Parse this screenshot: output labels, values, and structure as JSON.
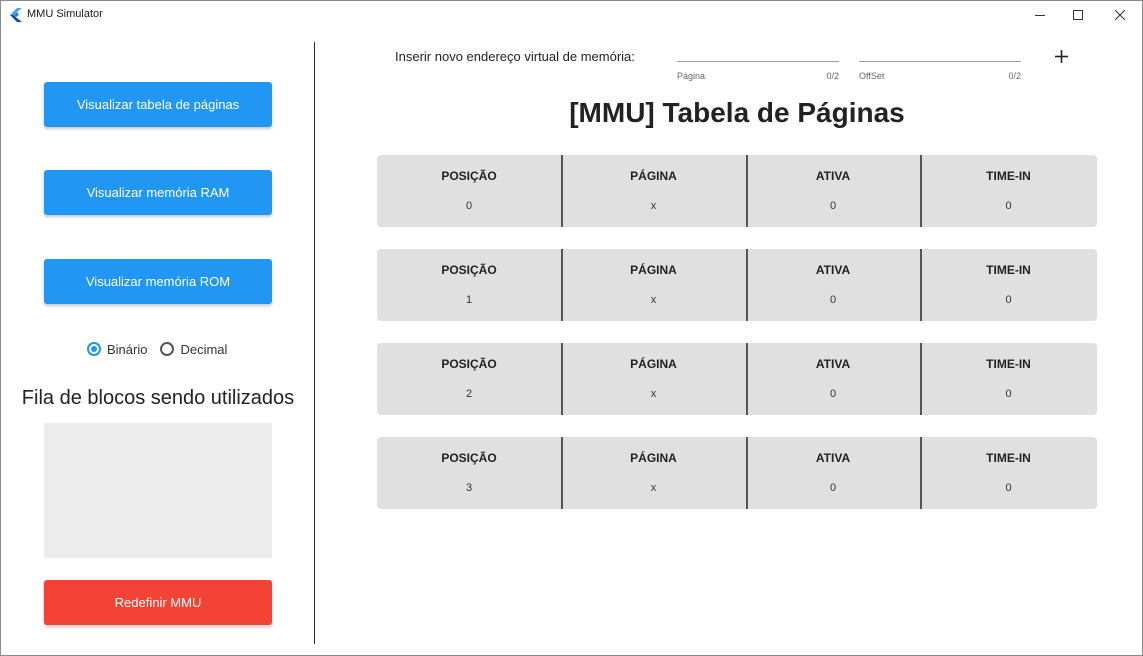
{
  "window": {
    "title": "MMU Simulator"
  },
  "sidebar": {
    "buttons": [
      {
        "label": "Visualizar tabela de páginas"
      },
      {
        "label": "Visualizar memória RAM"
      },
      {
        "label": "Visualizar memória ROM"
      }
    ],
    "radio": {
      "options": [
        "Binário",
        "Decimal"
      ],
      "selected": "Binário"
    },
    "queue_title": "Fila de blocos sendo utilizados",
    "reset_label": "Redefinir MMU"
  },
  "main": {
    "address_label": "Inserir novo endereço virtual de memória:",
    "page_field": {
      "helper": "Página",
      "counter": "0/2",
      "value": ""
    },
    "offset_field": {
      "helper": "OffSet",
      "counter": "0/2",
      "value": ""
    },
    "title": "[MMU] Tabela de Páginas",
    "columns": [
      "POSIÇÃO",
      "PÁGINA",
      "ATIVA",
      "TIME-IN"
    ],
    "rows": [
      [
        "0",
        "x",
        "0",
        "0"
      ],
      [
        "1",
        "x",
        "0",
        "0"
      ],
      [
        "2",
        "x",
        "0",
        "0"
      ],
      [
        "3",
        "x",
        "0",
        "0"
      ]
    ]
  },
  "colors": {
    "primary": "#2196f3",
    "danger": "#f44336",
    "row_bg": "#e0e0e0",
    "queue_bg": "#ececec"
  },
  "icons": [
    "app-logo-icon",
    "minimize-icon",
    "maximize-icon",
    "close-icon",
    "plus-icon"
  ]
}
